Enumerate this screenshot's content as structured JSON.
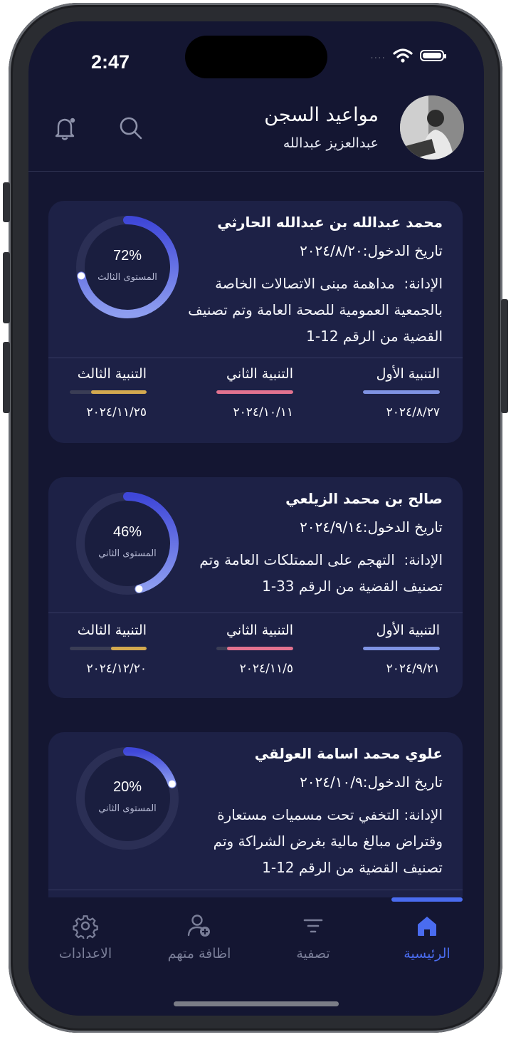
{
  "status_bar": {
    "time": "2:47",
    "signal_dots": "...."
  },
  "header": {
    "title": "مواعيد السجن",
    "subtitle": "عبدالعزيز عبدالله"
  },
  "cards": [
    {
      "name": "محمد عبدالله بن عبدالله الحارثي",
      "entry_label": "تاريخ الدخول:",
      "entry_date": "٢٠٢٤/٨/٢٠",
      "charge_label": "الإدانة:",
      "charge_text": "مداهمة مبنى الاتصالات الخاصة بالجمعية العمومية للصحة العامة وتم تصنيف القضية من الرقم 12-1",
      "progress_label": "72%",
      "progress": 0.72,
      "level": "المستوى الثالث",
      "warnings": [
        {
          "label": "التنبية الأول",
          "date": "٢٠٢٤/٨/٢٧",
          "fill": 1.0,
          "color": "#7f93e3"
        },
        {
          "label": "التنبية الثاني",
          "date": "٢٠٢٤/١٠/١١",
          "fill": 1.0,
          "color": "#e2728f"
        },
        {
          "label": "التنبية الثالث",
          "date": "٢٠٢٤/١١/٢٥",
          "fill": 0.72,
          "color": "#d3a94f"
        }
      ]
    },
    {
      "name": "صالح بن محمد الزيلعي",
      "entry_label": "تاريخ الدخول:",
      "entry_date": "٢٠٢٤/٩/١٤",
      "charge_label": "الإدانة:",
      "charge_text": "التهجم على الممتلكات العامة وتم تصنيف القضية من الرقم 33-1",
      "progress_label": "46%",
      "progress": 0.46,
      "level": "المستوى الثاني",
      "warnings": [
        {
          "label": "التنبية الأول",
          "date": "٢٠٢٤/٩/٢١",
          "fill": 1.0,
          "color": "#7f93e3"
        },
        {
          "label": "التنبية الثاني",
          "date": "٢٠٢٤/١١/٥",
          "fill": 0.86,
          "color": "#e2728f"
        },
        {
          "label": "التنبية الثالث",
          "date": "٢٠٢٤/١٢/٢٠",
          "fill": 0.46,
          "color": "#d3a94f"
        }
      ]
    },
    {
      "name": "علوي محمد اسامة العولقي",
      "entry_label": "تاريخ الدخول:",
      "entry_date": "٢٠٢٤/١٠/٩",
      "charge_label": "الإدانة:",
      "charge_text": "التخفي تحت مسميات مستعارة وقتراض مبالغ مالية بغرض الشراكة وتم تصنيف القضية من الرقم 12-1",
      "progress_label": "20%",
      "progress": 0.2,
      "level": "المستوى الثاني"
    }
  ],
  "tabs": [
    {
      "label": "الرئيسية",
      "icon": "home-icon",
      "active": true
    },
    {
      "label": "تصفية",
      "icon": "filter-icon",
      "active": false
    },
    {
      "label": "اظافة متهم",
      "icon": "add-user-icon",
      "active": false
    },
    {
      "label": "الاعدادات",
      "icon": "gear-icon",
      "active": false
    }
  ],
  "colors": {
    "background": "#141632",
    "card": "#1d2146",
    "accent": "#4a6cf0",
    "warning1": "#7f93e3",
    "warning2": "#e2728f",
    "warning3": "#d3a94f"
  }
}
